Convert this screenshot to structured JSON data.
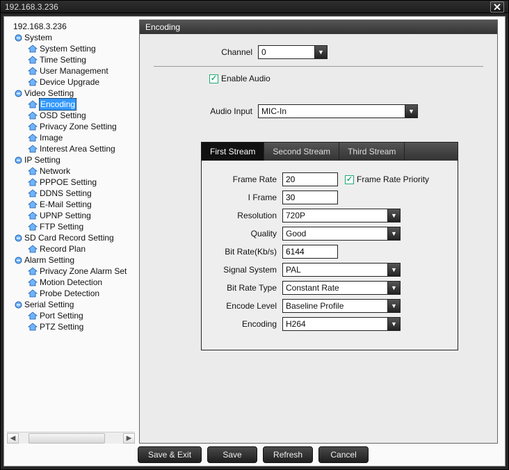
{
  "window": {
    "title": "192.168.3.236"
  },
  "tree": {
    "root": "192.168.3.236",
    "groups": [
      {
        "label": "System",
        "items": [
          "System Setting",
          "Time Setting",
          "User Management",
          "Device Upgrade"
        ]
      },
      {
        "label": "Video Setting",
        "items": [
          "Encoding",
          "OSD Setting",
          "Privacy Zone Setting",
          "Image",
          "Interest Area Setting"
        ],
        "selected": "Encoding"
      },
      {
        "label": "IP Setting",
        "items": [
          "Network",
          "PPPOE Setting",
          "DDNS Setting",
          "E-Mail Setting",
          "UPNP Setting",
          "FTP Setting"
        ]
      },
      {
        "label": "SD Card Record Setting",
        "items": [
          "Record Plan"
        ]
      },
      {
        "label": "Alarm Setting",
        "items": [
          "Privacy Zone Alarm Set",
          "Motion Detection",
          "Probe Detection"
        ]
      },
      {
        "label": "Serial Setting",
        "items": [
          "Port Setting",
          "PTZ Setting"
        ]
      }
    ]
  },
  "panel": {
    "title": "Encoding",
    "channel_label": "Channel",
    "channel_value": "0",
    "enable_audio_label": "Enable Audio",
    "enable_audio_checked": true,
    "audio_input_label": "Audio Input",
    "audio_input_value": "MIC-In",
    "tabs": [
      "First Stream",
      "Second Stream",
      "Third Stream"
    ],
    "active_tab": 0,
    "fields": {
      "frame_rate_label": "Frame Rate",
      "frame_rate_value": "20",
      "frame_rate_priority_label": "Frame Rate Priority",
      "frame_rate_priority_checked": true,
      "iframe_label": "I Frame",
      "iframe_value": "30",
      "resolution_label": "Resolution",
      "resolution_value": "720P",
      "quality_label": "Quality",
      "quality_value": "Good",
      "bitrate_label": "Bit Rate(Kb/s)",
      "bitrate_value": "6144",
      "signal_label": "Signal System",
      "signal_value": "PAL",
      "brtype_label": "Bit Rate Type",
      "brtype_value": "Constant Rate",
      "enclevel_label": "Encode Level",
      "enclevel_value": "Baseline Profile",
      "encoding_label": "Encoding",
      "encoding_value": "H264"
    }
  },
  "buttons": {
    "save_exit": "Save & Exit",
    "save": "Save",
    "refresh": "Refresh",
    "cancel": "Cancel"
  }
}
